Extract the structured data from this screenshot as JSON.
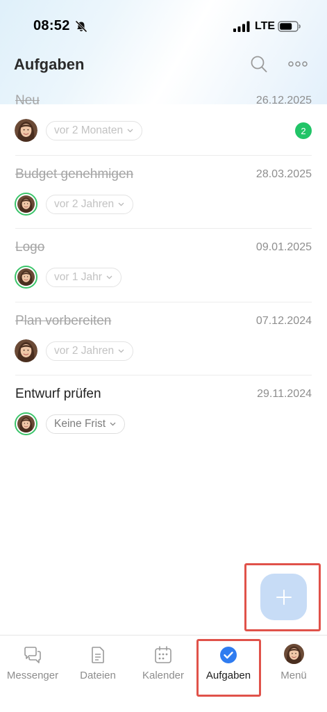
{
  "status_bar": {
    "time": "08:52",
    "network": "LTE",
    "icons": [
      "bell-off-icon",
      "signal-icon",
      "battery-icon"
    ]
  },
  "header": {
    "title": "Aufgaben",
    "icons": [
      "search-icon",
      "more-icon"
    ]
  },
  "tasks": [
    {
      "title": "Neu",
      "date": "26.12.2025",
      "deadline": "vor 2 Monaten",
      "completed": true,
      "badge": "2"
    },
    {
      "title": "Budget genehmigen",
      "date": "28.03.2025",
      "deadline": "vor 2 Jahren",
      "completed": true
    },
    {
      "title": "Logo",
      "date": "09.01.2025",
      "deadline": "vor 1 Jahr",
      "completed": true
    },
    {
      "title": "Plan vorbereiten",
      "date": "07.12.2024",
      "deadline": "vor 2 Jahren",
      "completed": true
    },
    {
      "title": "Entwurf prüfen",
      "date": "29.11.2024",
      "deadline": "Keine Frist",
      "completed": false
    }
  ],
  "fab": {
    "icon": "plus-icon"
  },
  "bottom_nav": {
    "items": [
      {
        "label": "Messenger",
        "icon": "chat-icon"
      },
      {
        "label": "Dateien",
        "icon": "document-icon"
      },
      {
        "label": "Kalender",
        "icon": "calendar-icon"
      },
      {
        "label": "Aufgaben",
        "icon": "checkmark-circle-icon",
        "active": true
      },
      {
        "label": "Menü",
        "icon": "avatar"
      }
    ]
  },
  "colors": {
    "accent": "#2f7cf0",
    "badge": "#21c467",
    "avatar_ring": "#3bc46a",
    "fab": "#c7dcf6",
    "highlight": "#e0524a"
  }
}
